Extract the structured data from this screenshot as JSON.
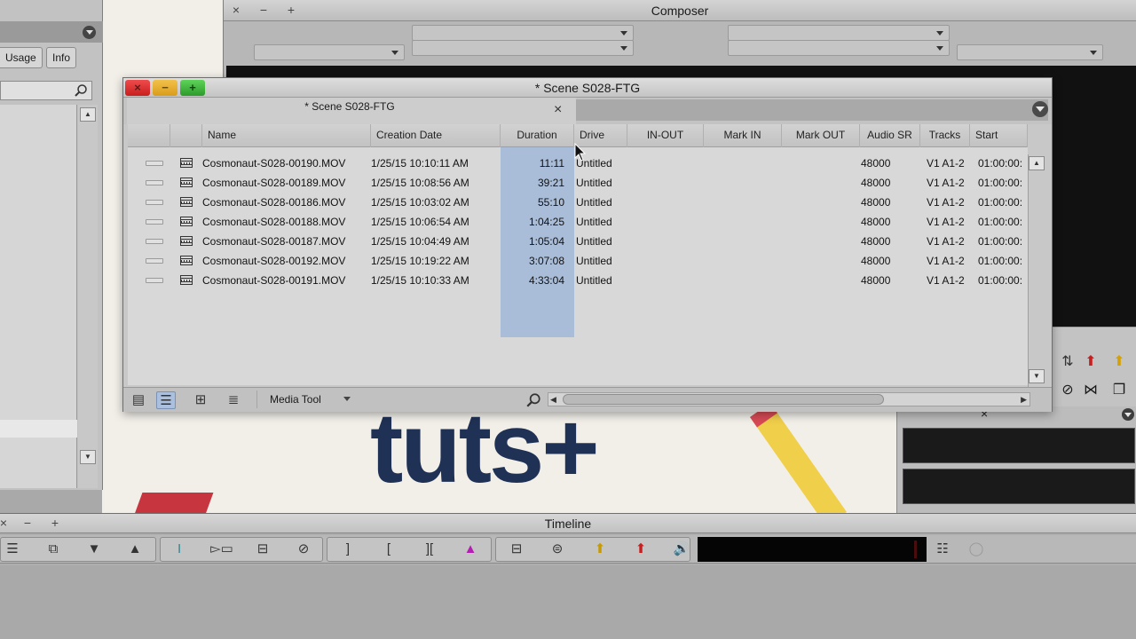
{
  "project": {
    "tabs": [
      {
        "label": "Usage"
      },
      {
        "label": "Info"
      }
    ]
  },
  "composer": {
    "title": "Composer",
    "window_buttons": [
      "×",
      "−",
      "+"
    ]
  },
  "bin": {
    "title": "* Scene S028-FTG",
    "tab_label": "* Scene S028-FTG",
    "tab_close": "×",
    "window_buttons": {
      "close": "×",
      "minimize": "−",
      "zoom": "+"
    },
    "columns": [
      "Name",
      "Creation Date",
      "Duration",
      "Drive",
      "IN-OUT",
      "Mark IN",
      "Mark OUT",
      "Audio SR",
      "Tracks",
      "Start"
    ],
    "rows": [
      {
        "name": "Cosmonaut-S028-00190.MOV",
        "creation_date": "1/25/15 10:10:11 AM",
        "duration": "11:11",
        "drive": "Untitled",
        "audio_sr": "48000",
        "tracks": "V1 A1-2",
        "start": "01:00:00:"
      },
      {
        "name": "Cosmonaut-S028-00189.MOV",
        "creation_date": "1/25/15 10:08:56 AM",
        "duration": "39:21",
        "drive": "Untitled",
        "audio_sr": "48000",
        "tracks": "V1 A1-2",
        "start": "01:00:00:"
      },
      {
        "name": "Cosmonaut-S028-00186.MOV",
        "creation_date": "1/25/15 10:03:02 AM",
        "duration": "55:10",
        "drive": "Untitled",
        "audio_sr": "48000",
        "tracks": "V1 A1-2",
        "start": "01:00:00:"
      },
      {
        "name": "Cosmonaut-S028-00188.MOV",
        "creation_date": "1/25/15 10:06:54 AM",
        "duration": "1:04:25",
        "drive": "Untitled",
        "audio_sr": "48000",
        "tracks": "V1 A1-2",
        "start": "01:00:00:"
      },
      {
        "name": "Cosmonaut-S028-00187.MOV",
        "creation_date": "1/25/15 10:04:49 AM",
        "duration": "1:05:04",
        "drive": "Untitled",
        "audio_sr": "48000",
        "tracks": "V1 A1-2",
        "start": "01:00:00:"
      },
      {
        "name": "Cosmonaut-S028-00192.MOV",
        "creation_date": "1/25/15 10:19:22 AM",
        "duration": "3:07:08",
        "drive": "Untitled",
        "audio_sr": "48000",
        "tracks": "V1 A1-2",
        "start": "01:00:00:"
      },
      {
        "name": "Cosmonaut-S028-00191.MOV",
        "creation_date": "1/25/15 10:10:33 AM",
        "duration": "4:33:04",
        "drive": "Untitled",
        "audio_sr": "48000",
        "tracks": "V1 A1-2",
        "start": "01:00:00:"
      }
    ],
    "bottom": {
      "media_tool": "Media Tool"
    }
  },
  "timeline": {
    "title": "Timeline",
    "window_buttons": [
      "×",
      "−",
      "+"
    ]
  },
  "background": {
    "logo_text": "tuts+"
  },
  "colors": {
    "duration_highlight": "#a9bdd8",
    "close_red": "#e03a3a",
    "minimize_yellow": "#f2c14a",
    "zoom_green": "#5ed35a",
    "logo_navy": "#1f3155"
  }
}
